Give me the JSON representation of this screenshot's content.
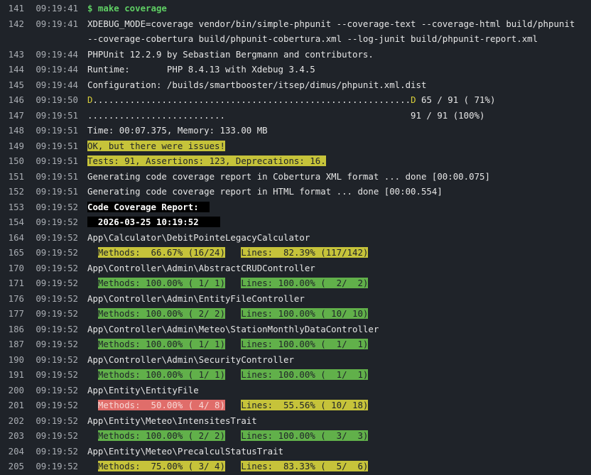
{
  "lines": [
    {
      "n": "141",
      "t": "09:19:41",
      "text": "$ make coverage",
      "style": "cmd"
    },
    {
      "n": "142",
      "t": "09:19:41",
      "text": "XDEBUG_MODE=coverage vendor/bin/simple-phpunit --coverage-text --coverage-html build/phpunit --coverage-cobertura build/phpunit-cobertura.xml --log-junit build/phpunit-report.xml",
      "style": "wrap"
    },
    {
      "n": "143",
      "t": "09:19:44",
      "text": "PHPUnit 12.2.9 by Sebastian Bergmann and contributors."
    },
    {
      "n": "144",
      "t": "09:19:44",
      "text": "Runtime:       PHP 8.4.13 with Xdebug 3.4.5"
    },
    {
      "n": "145",
      "t": "09:19:44",
      "text": "Configuration: /builds/smartbooster/itsep/dimus/phpunit.xml.dist"
    },
    {
      "n": "146",
      "t": "09:19:50",
      "pre": "D",
      "mid": "............................................................",
      "post": "D",
      "tail": " 65 / 91 ( 71%)",
      "style": "progress"
    },
    {
      "n": "147",
      "t": "09:19:51",
      "text": "..........................                                   91 / 91 (100%)"
    },
    {
      "n": "148",
      "t": "09:19:51",
      "text": "Time: 00:07.375, Memory: 133.00 MB"
    },
    {
      "n": "149",
      "t": "09:19:51",
      "text": "OK, but there were issues!",
      "style": "hl-y"
    },
    {
      "n": "150",
      "t": "09:19:51",
      "text": "Tests: 91, Assertions: 123, Deprecations: 16.",
      "style": "hl-y"
    },
    {
      "n": "151",
      "t": "09:19:51",
      "text": "Generating code coverage report in Cobertura XML format ... done [00:00.075]"
    },
    {
      "n": "152",
      "t": "09:19:51",
      "text": "Generating code coverage report in HTML format ... done [00:00.554]"
    },
    {
      "n": "153",
      "t": "09:19:52",
      "text": "Code Coverage Report:  ",
      "style": "hdr"
    },
    {
      "n": "154",
      "t": "09:19:52",
      "text": "  2026-03-25 10:19:52    ",
      "style": "hdr"
    },
    {
      "n": "164",
      "t": "09:19:52",
      "text": "App\\Calculator\\DebitPointeLegacyCalculator"
    },
    {
      "n": "165",
      "t": "09:19:52",
      "methods": "Methods:  66.67% (16/24)",
      "mstyle": "hl-y",
      "lines": "Lines:  82.39% (117/142)",
      "lstyle": "hl-y"
    },
    {
      "n": "170",
      "t": "09:19:52",
      "text": "App\\Controller\\Admin\\AbstractCRUDController"
    },
    {
      "n": "171",
      "t": "09:19:52",
      "methods": "Methods: 100.00% ( 1/ 1)",
      "mstyle": "hl-g",
      "lines": "Lines: 100.00% (  2/  2)",
      "lstyle": "hl-g"
    },
    {
      "n": "176",
      "t": "09:19:52",
      "text": "App\\Controller\\Admin\\EntityFileController"
    },
    {
      "n": "177",
      "t": "09:19:52",
      "methods": "Methods: 100.00% ( 2/ 2)",
      "mstyle": "hl-g",
      "lines": "Lines: 100.00% ( 10/ 10)",
      "lstyle": "hl-g"
    },
    {
      "n": "186",
      "t": "09:19:52",
      "text": "App\\Controller\\Admin\\Meteo\\StationMonthlyDataController"
    },
    {
      "n": "187",
      "t": "09:19:52",
      "methods": "Methods: 100.00% ( 1/ 1)",
      "mstyle": "hl-g",
      "lines": "Lines: 100.00% (  1/  1)",
      "lstyle": "hl-g"
    },
    {
      "n": "190",
      "t": "09:19:52",
      "text": "App\\Controller\\Admin\\SecurityController"
    },
    {
      "n": "191",
      "t": "09:19:52",
      "methods": "Methods: 100.00% ( 1/ 1)",
      "mstyle": "hl-g",
      "lines": "Lines: 100.00% (  1/  1)",
      "lstyle": "hl-g"
    },
    {
      "n": "200",
      "t": "09:19:52",
      "text": "App\\Entity\\EntityFile"
    },
    {
      "n": "201",
      "t": "09:19:52",
      "methods": "Methods:  50.00% ( 4/ 8)",
      "mstyle": "hl-r",
      "lines": "Lines:  55.56% ( 10/ 18)",
      "lstyle": "hl-y"
    },
    {
      "n": "202",
      "t": "09:19:52",
      "text": "App\\Entity\\Meteo\\IntensitesTrait"
    },
    {
      "n": "203",
      "t": "09:19:52",
      "methods": "Methods: 100.00% ( 2/ 2)",
      "mstyle": "hl-g",
      "lines": "Lines: 100.00% (  3/  3)",
      "lstyle": "hl-g"
    },
    {
      "n": "204",
      "t": "09:19:52",
      "text": "App\\Entity\\Meteo\\PrecalculStatusTrait"
    },
    {
      "n": "205",
      "t": "09:19:52",
      "methods": "Methods:  75.00% ( 3/ 4)",
      "mstyle": "hl-y",
      "lines": "Lines:  83.33% (  5/  6)",
      "lstyle": "hl-y"
    }
  ],
  "colors": {
    "background": "#1f2329",
    "command_green": "#5fcf64",
    "warning_yellow": "#c6c33a",
    "success_green": "#61b04a",
    "danger_red": "#e06d6a"
  }
}
